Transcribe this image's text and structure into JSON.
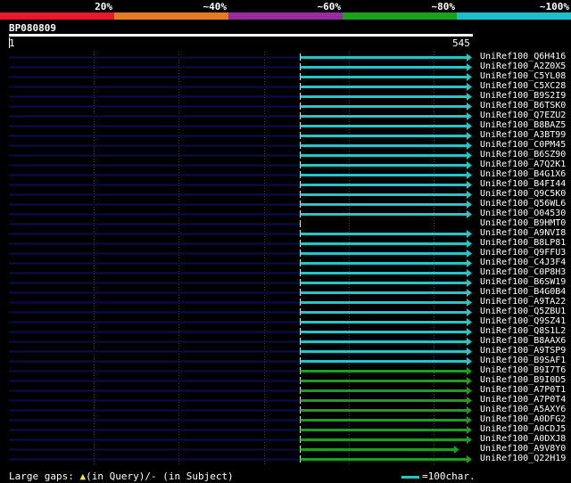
{
  "scale": {
    "labels": [
      "20%",
      "~40%",
      "~60%",
      "~80%",
      "~100%"
    ],
    "colors": [
      "#e8192c",
      "#e87a1f",
      "#9b2a9b",
      "#1aa31a",
      "#1ec0c8"
    ]
  },
  "query": {
    "name": "BP080809",
    "start": "1",
    "end": "545",
    "length": 545
  },
  "colors": {
    "track": "#0b0b4a",
    "cyan": "#26c6c6",
    "green": "#1e9e1e",
    "grid": "#404040",
    "marker": "#ffffff"
  },
  "hits": [
    {
      "id": "UniRef100_Q6H416",
      "start": 344,
      "end": 545,
      "color": "cyan"
    },
    {
      "id": "UniRef100_A2Z0X5",
      "start": 344,
      "end": 545,
      "color": "cyan"
    },
    {
      "id": "UniRef100_C5YL08",
      "start": 344,
      "end": 545,
      "color": "cyan"
    },
    {
      "id": "UniRef100_C5XC28",
      "start": 344,
      "end": 545,
      "color": "cyan"
    },
    {
      "id": "UniRef100_B9S2I9",
      "start": 344,
      "end": 545,
      "color": "cyan"
    },
    {
      "id": "UniRef100_B6TSK0",
      "start": 344,
      "end": 545,
      "color": "cyan"
    },
    {
      "id": "UniRef100_Q7EZU2",
      "start": 344,
      "end": 545,
      "color": "cyan"
    },
    {
      "id": "UniRef100_B8BAZ5",
      "start": 344,
      "end": 545,
      "color": "cyan"
    },
    {
      "id": "UniRef100_A3BT99",
      "start": 344,
      "end": 545,
      "color": "cyan"
    },
    {
      "id": "UniRef100_C0PM45",
      "start": 344,
      "end": 545,
      "color": "cyan"
    },
    {
      "id": "UniRef100_B6SZ90",
      "start": 344,
      "end": 545,
      "color": "cyan"
    },
    {
      "id": "UniRef100_A7Q2K1",
      "start": 344,
      "end": 545,
      "color": "cyan"
    },
    {
      "id": "UniRef100_B4G1X6",
      "start": 344,
      "end": 545,
      "color": "cyan"
    },
    {
      "id": "UniRef100_B4FI44",
      "start": 344,
      "end": 545,
      "color": "cyan"
    },
    {
      "id": "UniRef100_Q9C5K0",
      "start": 344,
      "end": 545,
      "color": "cyan"
    },
    {
      "id": "UniRef100_Q56WL6",
      "start": 344,
      "end": 545,
      "color": "cyan"
    },
    {
      "id": "UniRef100_O04530",
      "start": 344,
      "end": 545,
      "color": "cyan"
    },
    {
      "id": "UniRef100_B9HMT0",
      "start": 344,
      "end": 545,
      "color": "none"
    },
    {
      "id": "UniRef100_A9NVI8",
      "start": 344,
      "end": 545,
      "color": "cyan"
    },
    {
      "id": "UniRef100_B8LP81",
      "start": 344,
      "end": 545,
      "color": "cyan"
    },
    {
      "id": "UniRef100_Q9FFU3",
      "start": 344,
      "end": 545,
      "color": "cyan"
    },
    {
      "id": "UniRef100_C4J3F4",
      "start": 344,
      "end": 545,
      "color": "cyan"
    },
    {
      "id": "UniRef100_C0P8H3",
      "start": 344,
      "end": 545,
      "color": "cyan"
    },
    {
      "id": "UniRef100_B6SW19",
      "start": 344,
      "end": 545,
      "color": "cyan"
    },
    {
      "id": "UniRef100_B4G0B4",
      "start": 344,
      "end": 545,
      "color": "cyan"
    },
    {
      "id": "UniRef100_A9TA22",
      "start": 344,
      "end": 545,
      "color": "cyan"
    },
    {
      "id": "UniRef100_Q5ZBU1",
      "start": 344,
      "end": 545,
      "color": "cyan"
    },
    {
      "id": "UniRef100_Q9SZ41",
      "start": 344,
      "end": 545,
      "color": "cyan"
    },
    {
      "id": "UniRef100_Q8S1L2",
      "start": 344,
      "end": 545,
      "color": "cyan"
    },
    {
      "id": "UniRef100_B8AAX6",
      "start": 344,
      "end": 545,
      "color": "cyan"
    },
    {
      "id": "UniRef100_A9TSP9",
      "start": 344,
      "end": 545,
      "color": "cyan"
    },
    {
      "id": "UniRef100_B9SAF1",
      "start": 344,
      "end": 545,
      "color": "cyan"
    },
    {
      "id": "UniRef100_B9I7T6",
      "start": 344,
      "end": 545,
      "color": "green"
    },
    {
      "id": "UniRef100_B9I0D5",
      "start": 344,
      "end": 545,
      "color": "green"
    },
    {
      "id": "UniRef100_A7P0T1",
      "start": 344,
      "end": 545,
      "color": "green"
    },
    {
      "id": "UniRef100_A7P0T4",
      "start": 344,
      "end": 545,
      "color": "green"
    },
    {
      "id": "UniRef100_A5AXY6",
      "start": 344,
      "end": 545,
      "color": "green"
    },
    {
      "id": "UniRef100_A0DFG2",
      "start": 344,
      "end": 545,
      "color": "green"
    },
    {
      "id": "UniRef100_A0CDJ5",
      "start": 344,
      "end": 545,
      "color": "green"
    },
    {
      "id": "UniRef100_A0DXJ8",
      "start": 344,
      "end": 545,
      "color": "green"
    },
    {
      "id": "UniRef100_A9V8Y0",
      "start": 344,
      "end": 530,
      "color": "green"
    },
    {
      "id": "UniRef100_Q22H19",
      "start": 344,
      "end": 545,
      "color": "green"
    }
  ],
  "footer": {
    "gaps_label": "Large gaps:",
    "gaps_query": "(in Query)/",
    "gaps_subject": "- (in Subject)",
    "legend_text": "=100char."
  }
}
